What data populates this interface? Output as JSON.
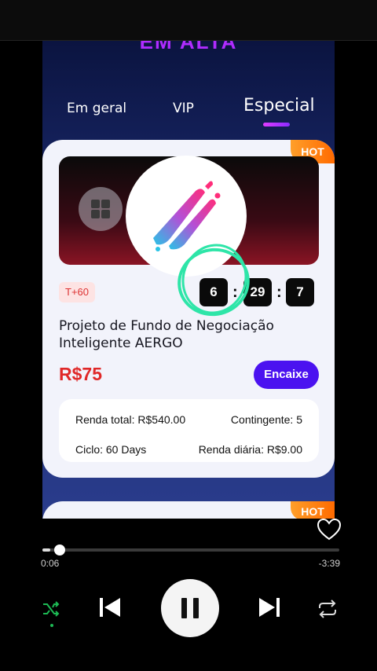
{
  "page": {
    "header_title": "EM ALTA"
  },
  "tabs": [
    {
      "label": "Em geral"
    },
    {
      "label": "VIP"
    },
    {
      "label": "Especial",
      "active": true
    }
  ],
  "product": {
    "hot_badge": "HOT",
    "days_badge": "T+60",
    "timer": {
      "hours": "6",
      "minutes": "29",
      "seconds": "7"
    },
    "title": "Projeto de Fundo de Negociação Inteligente AERGO",
    "price": "R$75",
    "button_label": "Encaixe",
    "info": {
      "total_income": "Renda total: R$540.00",
      "contingent": "Contingente: 5",
      "cycle": "Ciclo: 60 Days",
      "daily_income": "Renda diária: R$9.00"
    }
  },
  "next_product": {
    "hot_badge": "HOT"
  },
  "player": {
    "elapsed": "0:06",
    "remaining": "-3:39",
    "progress": 0.027,
    "icons": [
      "heart-icon",
      "shuffle-icon",
      "previous-icon",
      "pause-icon",
      "next-icon",
      "repeat-icon"
    ]
  },
  "colors": {
    "accent_tab": "#b02cff",
    "button": "#4b12f0",
    "price": "#e02828",
    "hot": "#ff7a10",
    "annotation": "#2ee5a8"
  }
}
